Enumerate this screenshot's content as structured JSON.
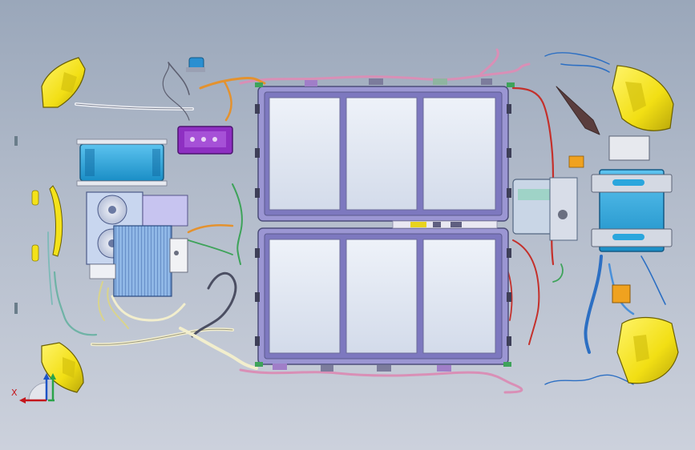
{
  "viewport": {
    "name": "cad-3d-assembly-view",
    "background_top": "#9aa7ba",
    "background_bottom": "#ccd1dc"
  },
  "model": {
    "view": "top",
    "components": [
      "battery-pack-upper",
      "battery-pack-lower",
      "motor-controller-box",
      "radiator-fan-module",
      "drive-motor",
      "auxiliary-battery",
      "purple-junction-box",
      "headlamp-front-left",
      "headlamp-front-right",
      "headlamp-rear-left",
      "headlamp-rear-right",
      "wiring-harness"
    ],
    "colors": {
      "battery_frame": "#8a83c9",
      "battery_cell": "#dfe6f1",
      "blue_box": "#2aa6dd",
      "lamp_yellow": "#f4e21a",
      "purple_box": "#8e2fc2",
      "wire_orange": "#e4922e",
      "wire_pink": "#d98fb6",
      "wire_green": "#3ea35a",
      "wire_grey": "#5d5f70",
      "wire_blue": "#2c6fc3",
      "wire_red": "#c4302b",
      "wire_cream": "#f2eecd"
    }
  },
  "triad": {
    "x_label": "X",
    "x_color": "#c4161c",
    "y_color": "#2aa34a",
    "z_color": "#1d54c6"
  }
}
